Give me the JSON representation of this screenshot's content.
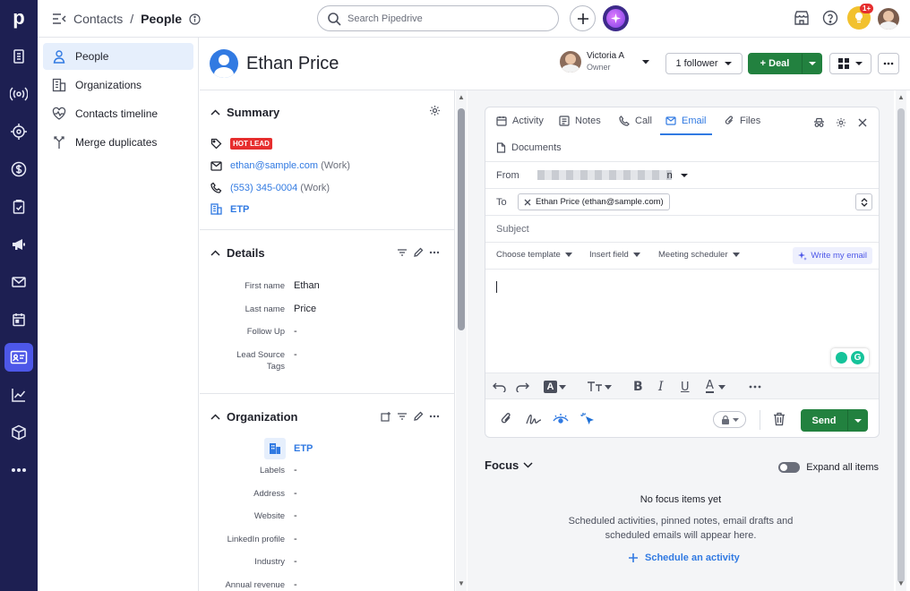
{
  "rail": {
    "logo": "p",
    "icons": [
      "building-icon",
      "broadcast-icon",
      "target-icon",
      "dollar-icon",
      "clipboard-icon",
      "megaphone-icon",
      "mail-icon",
      "calendar-icon",
      "contacts-icon",
      "chart-icon",
      "box-icon",
      "more-icon"
    ]
  },
  "topbar": {
    "breadcrumb_parent": "Contacts",
    "breadcrumb_sep": "/",
    "breadcrumb_current": "People",
    "search_placeholder": "Search Pipedrive",
    "notification_badge": "1+"
  },
  "subnav": {
    "items": [
      {
        "label": "People",
        "icon": "person-icon"
      },
      {
        "label": "Organizations",
        "icon": "building-icon"
      },
      {
        "label": "Contacts timeline",
        "icon": "heart-pulse-icon"
      },
      {
        "label": "Merge duplicates",
        "icon": "merge-icon"
      }
    ]
  },
  "header": {
    "name": "Ethan Price",
    "owner_name": "Victoria A",
    "owner_role": "Owner",
    "follower_label": "1 follower",
    "deal_label": "+ Deal"
  },
  "summary": {
    "title": "Summary",
    "tag": "HOT LEAD",
    "email": "ethan@sample.com",
    "email_type": "(Work)",
    "phone": "(553) 345-0004",
    "phone_type": "(Work)",
    "org": "ETP"
  },
  "details": {
    "title": "Details",
    "fields": [
      {
        "label": "First name",
        "value": "Ethan"
      },
      {
        "label": "Last name",
        "value": "Price"
      },
      {
        "label": "Follow Up",
        "value": "-"
      },
      {
        "label": "Lead Source",
        "value": "-"
      },
      {
        "label": "Tags",
        "value": ""
      }
    ]
  },
  "organization": {
    "title": "Organization",
    "name": "ETP",
    "fields": [
      {
        "label": "Labels",
        "value": "-"
      },
      {
        "label": "Address",
        "value": "-"
      },
      {
        "label": "Website",
        "value": "-"
      },
      {
        "label": "LinkedIn profile",
        "value": "-"
      },
      {
        "label": "Industry",
        "value": "-"
      },
      {
        "label": "Annual revenue",
        "value": "-"
      }
    ]
  },
  "composer": {
    "tabs": [
      {
        "label": "Activity",
        "icon": "calendar-check-icon"
      },
      {
        "label": "Notes",
        "icon": "note-icon"
      },
      {
        "label": "Call",
        "icon": "phone-icon"
      },
      {
        "label": "Email",
        "icon": "mail-icon"
      },
      {
        "label": "Files",
        "icon": "paperclip-icon"
      }
    ],
    "documents_label": "Documents",
    "from_label": "From",
    "from_visible_suffix": "n",
    "to_label": "To",
    "to_chip": "Ethan Price (ethan@sample.com)",
    "subject_placeholder": "Subject",
    "choose_template": "Choose template",
    "insert_field": "Insert field",
    "meeting_scheduler": "Meeting scheduler",
    "write_email": "Write my email",
    "send_label": "Send"
  },
  "focus": {
    "title": "Focus",
    "expand_label": "Expand all items",
    "empty_title": "No focus items yet",
    "empty_text": "Scheduled activities, pinned notes, email drafts and scheduled emails will appear here.",
    "schedule_label": "Schedule an activity"
  }
}
